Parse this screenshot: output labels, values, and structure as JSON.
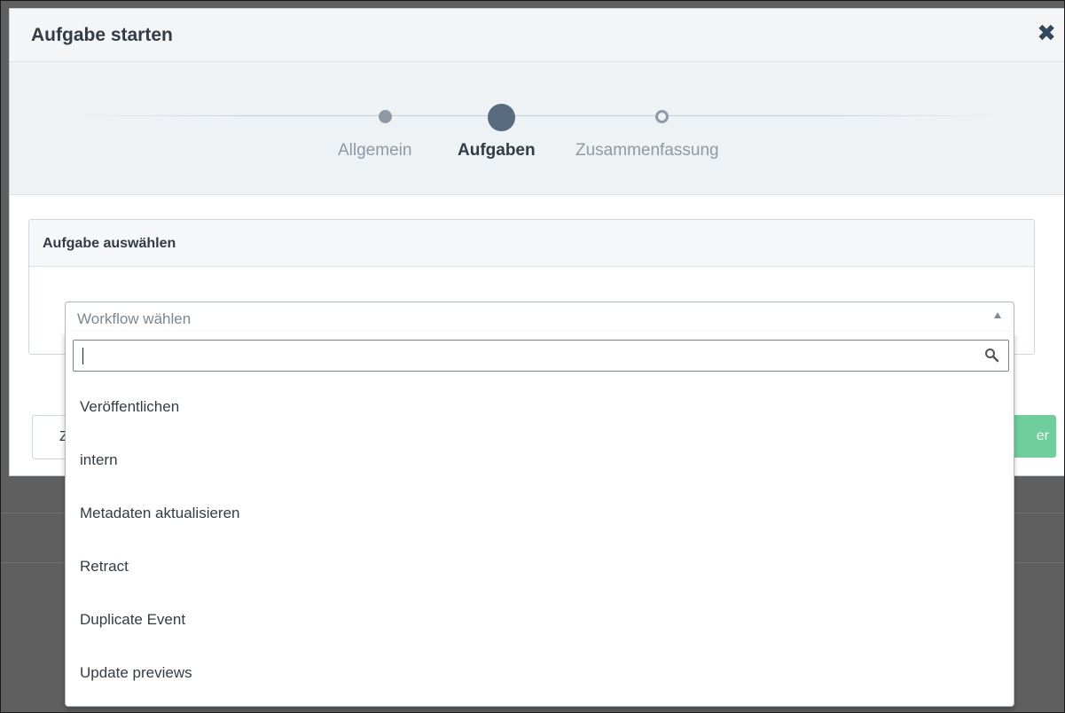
{
  "modal": {
    "title": "Aufgabe starten",
    "close_icon": "close-icon"
  },
  "stepper": {
    "steps": [
      {
        "label": "Allgemein",
        "state": "done"
      },
      {
        "label": "Aufgaben",
        "state": "active"
      },
      {
        "label": "Zusammenfassung",
        "state": "pending"
      }
    ]
  },
  "panel": {
    "title": "Aufgabe auswählen"
  },
  "select": {
    "placeholder": "Workflow wählen",
    "arrow_icon": "caret-up-icon",
    "search_value": "",
    "search_icon": "search-icon",
    "options": [
      "Veröffentlichen",
      "intern",
      "Metadaten aktualisieren",
      "Retract",
      "Duplicate Event",
      "Update previews"
    ]
  },
  "footer": {
    "left_button_partial": "Z",
    "right_button_partial": "er"
  },
  "colors": {
    "header_text": "#333c45",
    "step_active": "#586b7f",
    "step_inactive": "#8d9aa5",
    "primary_button": "#6fcf9c",
    "backdrop": "#5f5f5f"
  }
}
